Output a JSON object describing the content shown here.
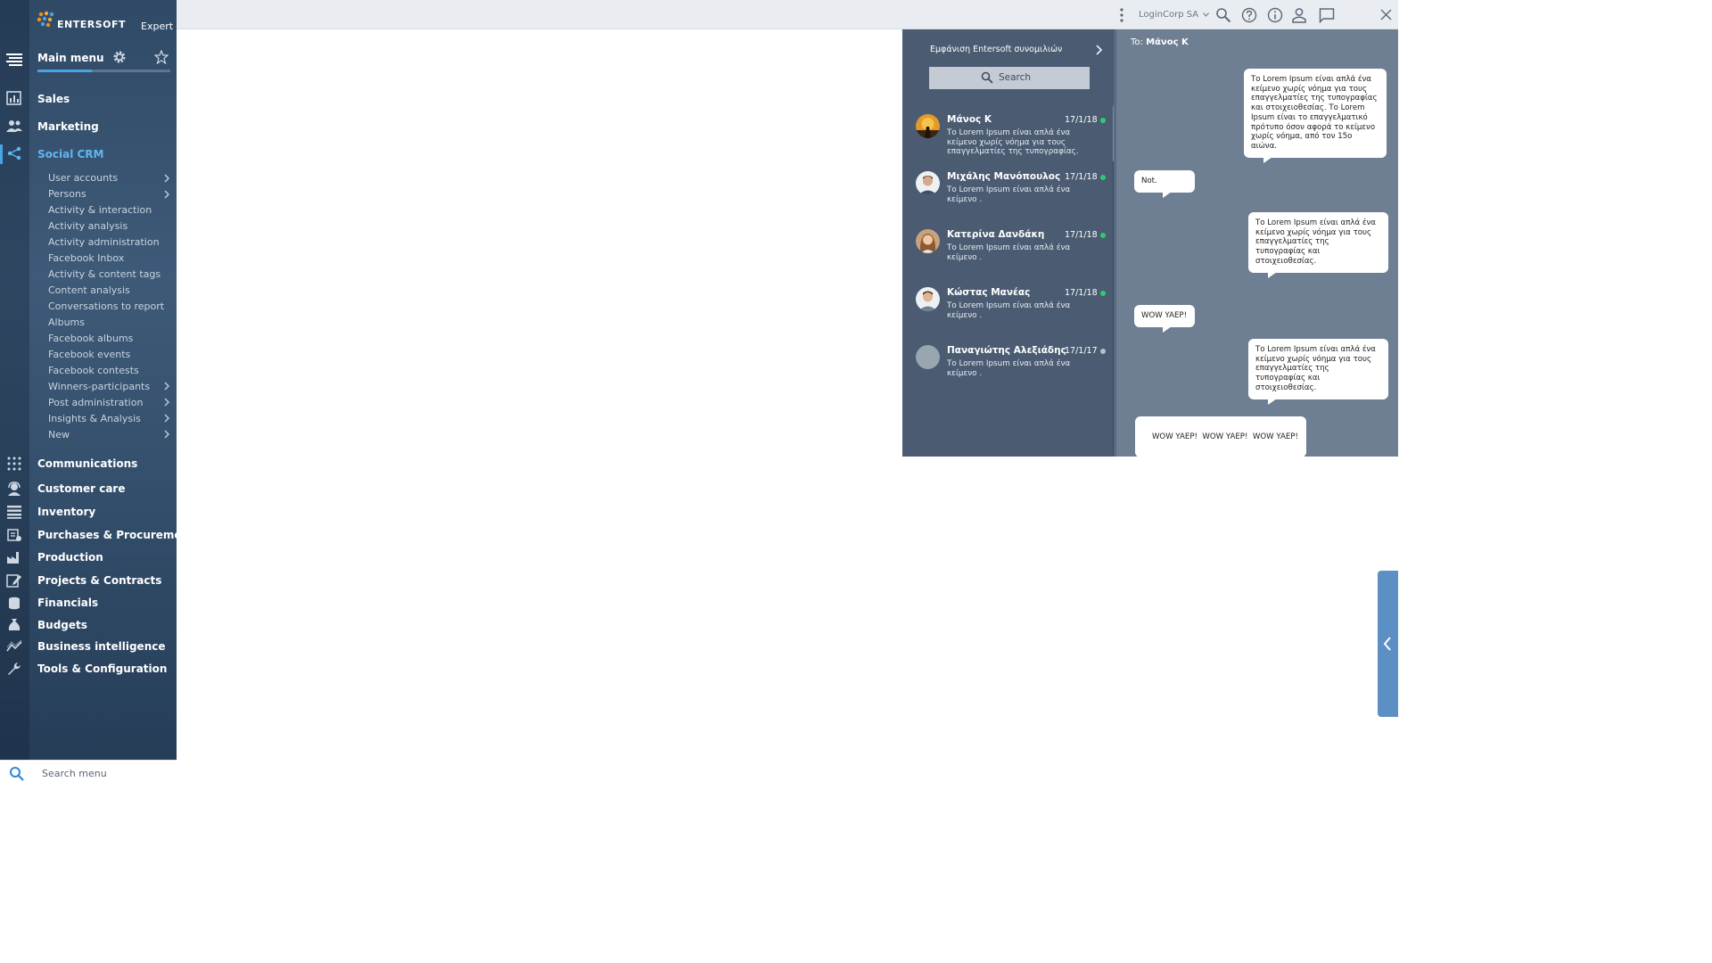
{
  "brand": {
    "name": "ENTERSOFT",
    "edition": "Expert"
  },
  "sidebar": {
    "main_menu_label": "Main menu",
    "modules_top": [
      {
        "label": "Sales",
        "icon": "chart-icon"
      },
      {
        "label": "Marketing",
        "icon": "people-icon"
      },
      {
        "label": "Social CRM",
        "icon": "share-icon",
        "active": true
      }
    ],
    "social_crm_items": [
      {
        "label": "User accounts",
        "has_children": true
      },
      {
        "label": "Persons",
        "has_children": true
      },
      {
        "label": "Activity & interaction",
        "has_children": false
      },
      {
        "label": "Activity analysis",
        "has_children": false
      },
      {
        "label": "Activity administration",
        "has_children": false
      },
      {
        "label": "Facebook Inbox",
        "has_children": false
      },
      {
        "label": "Activity & content tags",
        "has_children": false
      },
      {
        "label": "Content analysis",
        "has_children": false
      },
      {
        "label": "Conversations to report",
        "has_children": false
      },
      {
        "label": "Albums",
        "has_children": false
      },
      {
        "label": "Facebook albums",
        "has_children": false
      },
      {
        "label": "Facebook events",
        "has_children": false
      },
      {
        "label": "Facebook contests",
        "has_children": false
      },
      {
        "label": "Winners-participants",
        "has_children": true
      },
      {
        "label": "Post administration",
        "has_children": true
      },
      {
        "label": "Insights & Analysis",
        "has_children": true
      },
      {
        "label": "New",
        "has_children": true
      }
    ],
    "modules_bottom": [
      {
        "label": "Communications",
        "icon": "grid-icon"
      },
      {
        "label": "Customer care",
        "icon": "headset-icon"
      },
      {
        "label": "Inventory",
        "icon": "list-icon"
      },
      {
        "label": "Purchases & Procurement",
        "icon": "cart-icon"
      },
      {
        "label": "Production",
        "icon": "factory-icon"
      },
      {
        "label": "Projects & Contracts",
        "icon": "edit-icon"
      },
      {
        "label": "Financials",
        "icon": "coins-icon"
      },
      {
        "label": "Budgets",
        "icon": "money-bag-icon"
      },
      {
        "label": "Business intelligence",
        "icon": "trend-icon"
      },
      {
        "label": "Tools & Configuration",
        "icon": "wrench-icon"
      }
    ],
    "search_placeholder": "Search menu"
  },
  "topbar": {
    "company": "LoginCorp SA",
    "icons": [
      "more-vertical-icon",
      "search-icon",
      "help-icon",
      "info-icon",
      "user-icon",
      "chat-icon",
      "close-icon"
    ]
  },
  "conversations": {
    "title": "Εμφάνιση Entersoft συνομιλιών",
    "search_label": "Search",
    "items": [
      {
        "name": "Μάνος Κ",
        "date": "17/1/18",
        "online": true,
        "preview": "Το Lorem Ipsum είναι απλά ένα κείμενο χωρίς νόημα για τους επαγγελματίες της τυπογραφίας."
      },
      {
        "name": "Μιχάλης Μανόπουλος",
        "date": "17/1/18",
        "online": true,
        "preview": "Το Lorem Ipsum είναι απλά ένα κείμενο ."
      },
      {
        "name": "Κατερίνα Δανδάκη",
        "date": "17/1/18",
        "online": true,
        "preview": "Το Lorem Ipsum είναι απλά ένα κείμενο ."
      },
      {
        "name": "Κώστας Μανέας",
        "date": "17/1/18",
        "online": true,
        "preview": "Το Lorem Ipsum είναι απλά ένα κείμενο ."
      },
      {
        "name": "Παναγιώτης Αλεξιάδης",
        "date": "17/1/17",
        "online": false,
        "preview": "Το Lorem Ipsum είναι απλά ένα κείμενο ."
      }
    ]
  },
  "chat": {
    "to_label": "To:",
    "to_name": "Μάνος Κ",
    "messages": [
      {
        "side": "right",
        "text": "Το Lorem Ipsum είναι απλά ένα κείμενο χωρίς νόημα για τους επαγγελματίες της τυπογραφίας και στοιχειοθεσίας. Το Lorem Ipsum είναι το επαγγελματικό πρότυπο όσον αφορά το κείμενο χωρίς νόημα, από τον 15ο αιώνα."
      },
      {
        "side": "left",
        "text": "Not."
      },
      {
        "side": "right",
        "text": "Το Lorem Ipsum είναι απλά ένα κείμενο χωρίς νόημα για τους επαγγελματίες της τυπογραφίας και στοιχειοθεσίας."
      },
      {
        "side": "left",
        "text": "WOW YAEP!"
      },
      {
        "side": "right",
        "text": "Το Lorem Ipsum είναι απλά ένα κείμενο χωρίς νόημα για τους επαγγελματίες της τυπογραφίας και στοιχειοθεσίας."
      },
      {
        "side": "left",
        "text": "WOW YAEP!  WOW YAEP!  WOW YAEP!"
      }
    ]
  },
  "colors": {
    "accent": "#4aa3e6",
    "online": "#2ecc71",
    "offline": "#b8c0ca",
    "conv_panel": "#4a5b72",
    "chat_bg": "#6e7e93"
  }
}
